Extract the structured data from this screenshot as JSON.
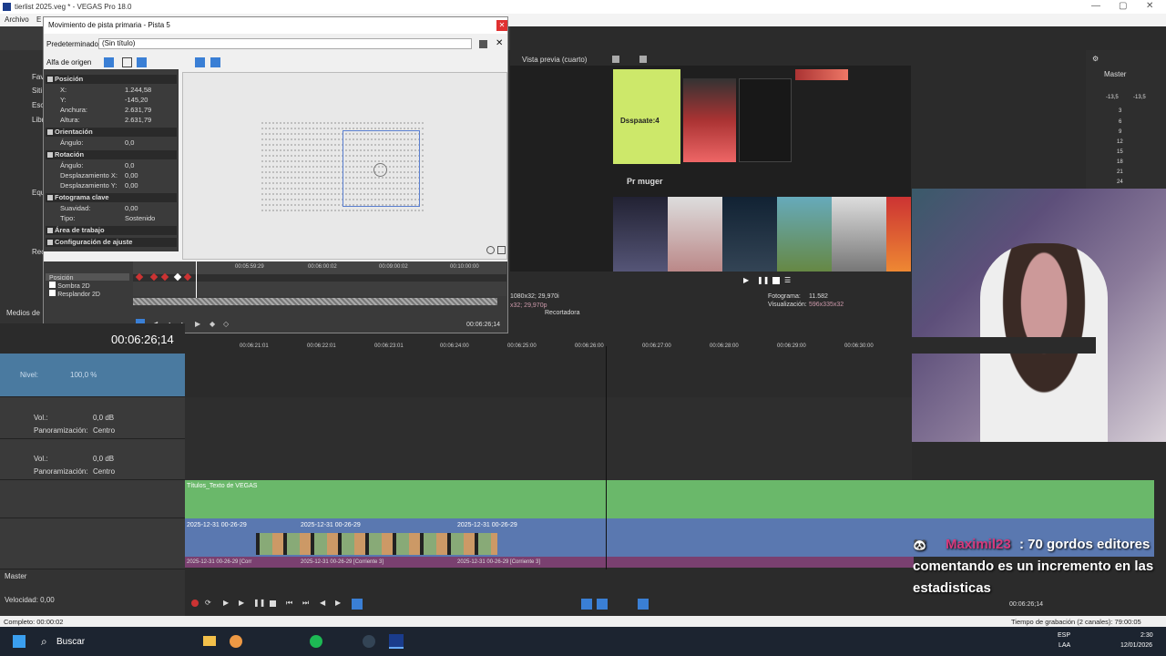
{
  "window": {
    "title": "tierlist 2025.veg * - VEGAS Pro 18.0",
    "minimize": "—",
    "maximize": "▢",
    "close": "✕"
  },
  "menu": {
    "file": "Archivo",
    "edit": "E"
  },
  "dialog": {
    "title": "Movimiento de pista primaria - Pista 5",
    "preset_label": "Predeterminado:",
    "preset_value": "(Sin título)",
    "alpha_label": "Alfa de origen"
  },
  "props": {
    "position": {
      "title": "Posición",
      "x_label": "X:",
      "x": "1.244,58",
      "y_label": "Y:",
      "y": "-145,20",
      "w_label": "Anchura:",
      "w": "2.631,79",
      "h_label": "Altura:",
      "h": "2.631,79"
    },
    "orientation": {
      "title": "Orientación",
      "angle_label": "Ángulo:",
      "angle": "0,0"
    },
    "rotation": {
      "title": "Rotación",
      "angle_label": "Ángulo:",
      "angle": "0,0",
      "dx_label": "Desplazamiento X:",
      "dx": "0,00",
      "dy_label": "Desplazamiento Y:",
      "dy": "0,00"
    },
    "keyframe": {
      "title": "Fotograma clave",
      "smooth_label": "Suavidad:",
      "smooth": "0,00",
      "type_label": "Tipo:",
      "type": "Sostenido"
    },
    "workarea": {
      "title": "Área de trabajo"
    },
    "snap": {
      "title": "Configuración de ajuste"
    }
  },
  "kf": {
    "ticks": [
      "00:05:59:29",
      "00:06:00:02",
      "00:09:00:02",
      "00:10:00:00"
    ],
    "tracks": [
      "Posición",
      "Sombra 2D",
      "Resplandor 2D"
    ],
    "time": "00:06:26;14"
  },
  "left": {
    "items": [
      "Fav",
      "Siti",
      "Esc",
      "Libr",
      "Equ",
      "Rec"
    ],
    "media": "Medios de"
  },
  "preview": {
    "label": "Vista previa (cuarto)",
    "frame_label": "Fotograma:",
    "frame": "11.582",
    "display_label": "Visualización:",
    "display": "596x335x32",
    "res1": "1080x32; 29,970i",
    "res2": "x32; 29,970p",
    "recorder": "Recortadora",
    "tier_label": "Pr muger",
    "tier_text": "Dsspaate:4"
  },
  "mixer": {
    "label": "Master",
    "values": [
      "-13,5",
      "-13,5"
    ],
    "scale": [
      "3",
      "6",
      "9",
      "12",
      "15",
      "18",
      "21",
      "24"
    ]
  },
  "timeline": {
    "time": "00:06:26;14",
    "ticks": [
      "00:06:21:01",
      "00:06:22:01",
      "00:06:23:01",
      "00:06:24:00",
      "00:06:25:00",
      "00:06:26:00",
      "00:06:27:00",
      "00:06:28:00",
      "00:06:29:00",
      "00:06:30:00"
    ],
    "level_label": "Nivel:",
    "level": "100,0 %",
    "vol_label": "Vol.:",
    "vol": "0,0 dB",
    "pan_label": "Panoramización:",
    "pan": "Centro",
    "title_clip": "Títulos_Texto de VEGAS",
    "clips": [
      "2025-12-31 00-26-29",
      "2025-12-31 00-26-29",
      "2025-12-31 00-26-29"
    ],
    "sub_clips": [
      "2025-12-31 00-26-29 [Corr",
      "2025-12-31 00-26-29 [Corriente 3]",
      "2025-12-31 00-26-29 [Corriente 3]"
    ],
    "master": "Master",
    "speed": "Velocidad: 0,00",
    "scale_nums": [
      "12",
      "24",
      "36",
      "48"
    ]
  },
  "chat": {
    "user": "Maximil23",
    "line1": ": 70 gordos editores",
    "line2": "comentando es un incremento en las",
    "line3": "estadisticas"
  },
  "status": {
    "left": "Completo: 00:00:02",
    "right": "Tiempo de grabación (2 canales): 79:00:05",
    "time": "00:06:26;14"
  },
  "taskbar": {
    "search": "Buscar",
    "lang": "ESP",
    "lang2": "LAA",
    "clock": "2:30",
    "date": "12/01/2026"
  }
}
